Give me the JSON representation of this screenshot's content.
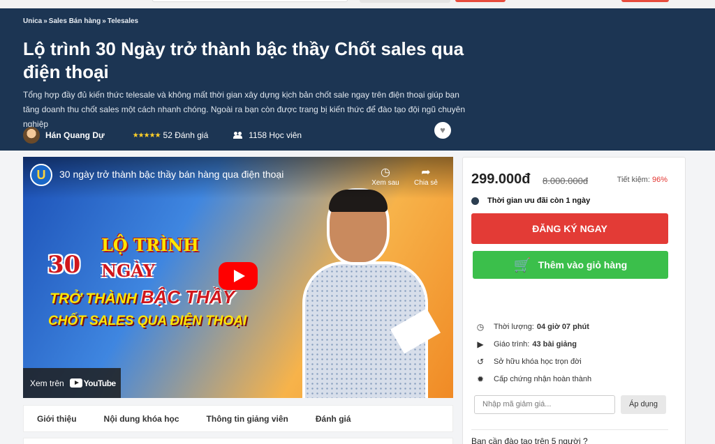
{
  "breadcrumb": [
    "Unica",
    "Sales Bán hàng",
    "Telesales"
  ],
  "breadcrumb_sep": "»",
  "course": {
    "title": "Lộ trình 30 Ngày trở thành bậc thầy Chốt sales qua điện thoại",
    "description": "Tổng hợp đầy đủ kiến thức telesale và không mất thời gian xây dựng kịch bản chốt sale ngay trên điện thoại giúp bạn tăng doanh thu chốt sales một cách nhanh chóng. Ngoài ra bạn còn được trang bị kiến thức để đào tạo đội ngũ chuyên nghiệp",
    "author": "Hán Quang Dự",
    "stars": "★★★★★",
    "ratings": "52 Đánh giá",
    "students": "1158 Học viên"
  },
  "video": {
    "channel_logo": "U",
    "title": "30 ngày trở thành bậc thầy bán hàng qua điện thoại",
    "watch_later": "Xem sau",
    "share": "Chia sẻ",
    "watch_on": "Xem trên",
    "youtube": "YouTube",
    "thumb_lines": [
      "LỘ TRÌNH",
      "30",
      "NGÀY",
      "TRỞ THÀNH",
      "BẬC THẦY",
      "CHỐT SALES QUA ĐIỆN THOẠI"
    ]
  },
  "tabs": [
    "Giới thiệu",
    "Nội dung khóa học",
    "Thông tin giảng viên",
    "Đánh giá"
  ],
  "purchase": {
    "price": "299.000đ",
    "old_price": "8.000.000đ",
    "saving_label": "Tiết kiệm:",
    "saving_value": "96%",
    "offer": "Thời gian ưu đãi còn 1 ngày",
    "register": "ĐĂNG KÝ NGAY",
    "add_cart": "Thêm vào giỏ hàng",
    "features": [
      {
        "label": "Thời lượng:",
        "value": "04 giờ 07 phút"
      },
      {
        "label": "Giáo trình:",
        "value": "43 bài giảng"
      },
      {
        "label": "Sở hữu khóa học trọn đời",
        "value": ""
      },
      {
        "label": "Cấp chứng nhận hoàn thành",
        "value": ""
      }
    ],
    "coupon_placeholder": "Nhập mã giảm giá...",
    "apply": "Áp dụng",
    "train_question": "Bạn cần đào tạo trên 5 người ?"
  }
}
